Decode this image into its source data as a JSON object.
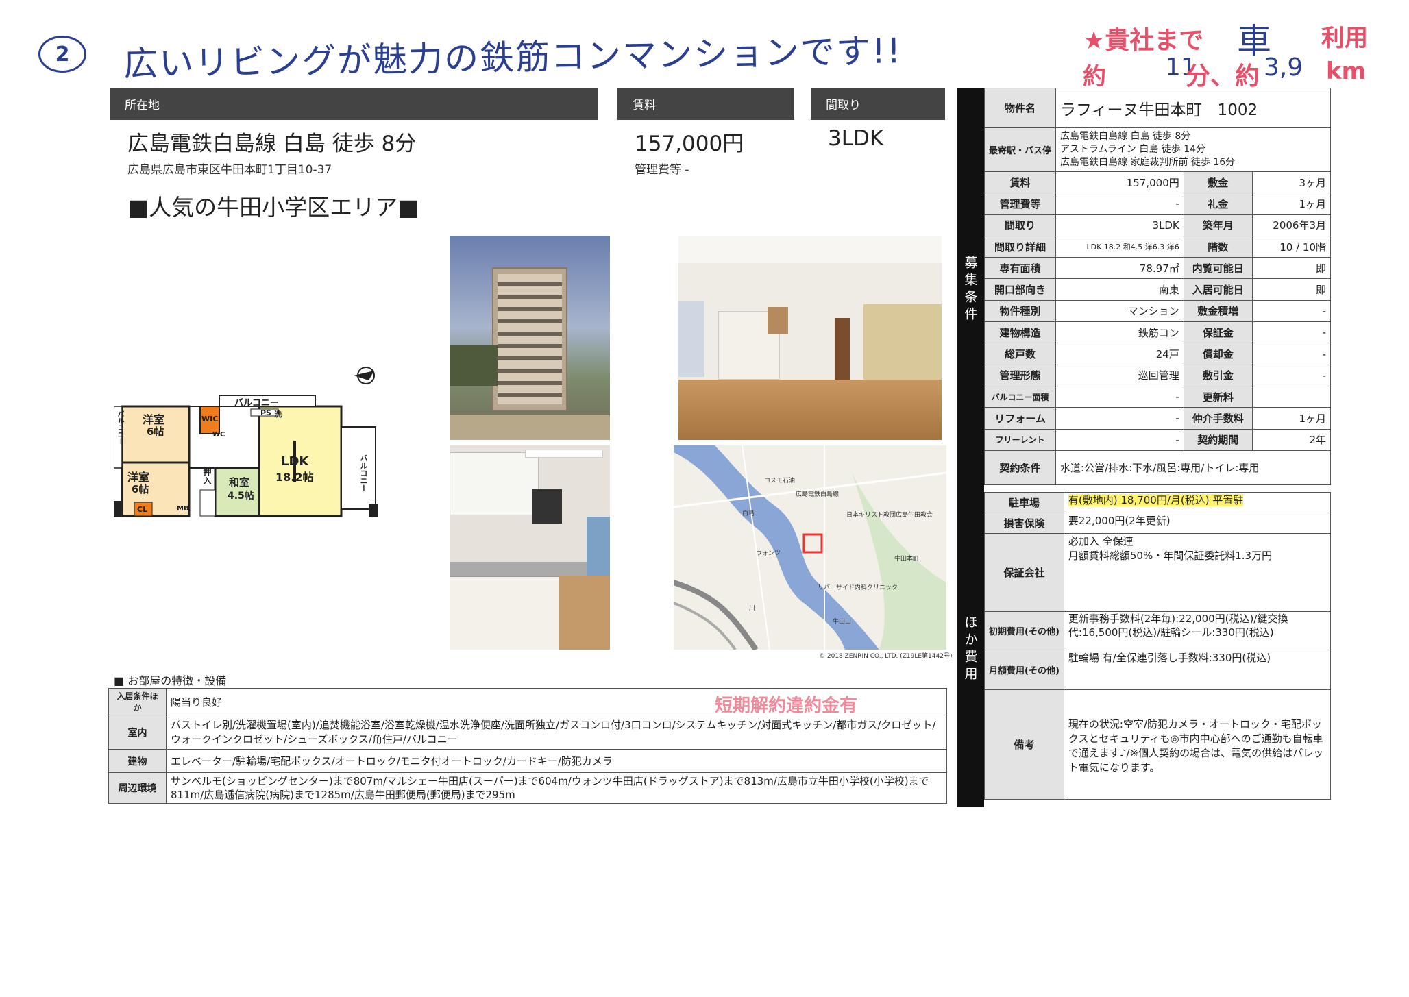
{
  "handwritten": {
    "circle_number": "2",
    "headline": "広いリビングが魅力の鉄筋コンマンションです!!"
  },
  "stamp": {
    "line1": "★貴社まで",
    "line1_hand": "車",
    "line1_right": "利用",
    "line2": "約",
    "line2_hand": "11",
    "line2_mid": "分、約",
    "line2_hand2": "3,9",
    "line2_unit": "km"
  },
  "location": {
    "label": "所在地",
    "station": "広島電鉄白島線 白島 徒歩 8分",
    "address": "広島県広島市東区牛田本町1丁目10-37"
  },
  "rent": {
    "label": "賃料",
    "value": "157,000円",
    "mgmt": "管理費等 -"
  },
  "layout": {
    "label": "間取り",
    "value": "3LDK"
  },
  "catch": "■人気の牛田小学区エリア■",
  "floorplan": {
    "balcony_top": "バルコニー",
    "room1": "洋室",
    "room1_size": "6帖",
    "room2": "洋室",
    "room2_size": "6帖",
    "ldk": "LDK",
    "ldk_size": "18.2帖",
    "washitsu": "和室",
    "washitsu_size": "4.5帖",
    "wic": "WIC",
    "ps": "PS",
    "sen": "洗",
    "cl": "CL",
    "mb": "MB",
    "oshi": "押入",
    "wc": "WC",
    "balcony_right": "バルコニー",
    "balcony_left": "バルコニー"
  },
  "map": {
    "copyright": "© 2018 ZENRIN CO., LTD. (Z19LE第1442号)",
    "labels": [
      "コスモ石油",
      "広島電鉄白島線",
      "日本キリスト教団広島牛田教会",
      "リバーサイド内科クリニック",
      "牛田本町",
      "白島",
      "ウォンツ",
      "川",
      "牛田山"
    ]
  },
  "sections": {
    "recruit": "募集条件",
    "other": "ほか費用"
  },
  "spec": {
    "name_label": "物件名",
    "name": "ラフィーヌ牛田本町　1002",
    "station_label": "最寄駅・バス停",
    "stations": [
      "広島電鉄白島線 白島 徒歩 8分",
      "アストラムライン 白島 徒歩 14分",
      "広島電鉄白島線 家庭裁判所前 徒歩 16分"
    ],
    "rows": [
      [
        "賃料",
        "157,000円",
        "敷金",
        "3ヶ月"
      ],
      [
        "管理費等",
        "-",
        "礼金",
        "1ヶ月"
      ],
      [
        "間取り",
        "3LDK",
        "築年月",
        "2006年3月"
      ],
      [
        "間取り詳細",
        "LDK 18.2 和4.5 洋6.3 洋6",
        "階数",
        "10 / 10階"
      ],
      [
        "専有面積",
        "78.97㎡",
        "内覧可能日",
        "即"
      ],
      [
        "開口部向き",
        "南東",
        "入居可能日",
        "即"
      ],
      [
        "物件種別",
        "マンション",
        "敷金積増",
        "-"
      ],
      [
        "建物構造",
        "鉄筋コン",
        "保証金",
        "-"
      ],
      [
        "総戸数",
        "24戸",
        "償却金",
        "-"
      ],
      [
        "管理形態",
        "巡回管理",
        "敷引金",
        "-"
      ],
      [
        "バルコニー面積",
        "-",
        "更新料",
        ""
      ],
      [
        "リフォーム",
        "-",
        "仲介手数料",
        "1ヶ月"
      ],
      [
        "フリーレント",
        "-",
        "契約期間",
        "2年"
      ]
    ],
    "contract_label": "契約条件",
    "contract": "水道:公営/排水:下水/風呂:専用/トイレ:専用"
  },
  "other": {
    "parking_label": "駐車場",
    "parking": "有(敷地内) 18,700円/月(税込) 平置駐",
    "insurance_label": "損害保険",
    "insurance": "要22,000円(2年更新)",
    "guarantee_label": "保証会社",
    "guarantee1": "必加入 全保連",
    "guarantee2": "月額賃料総額50%・年間保証委託料1.3万円",
    "initial_label": "初期費用(その他)",
    "initial": "更新事務手数料(2年毎):22,000円(税込)/鍵交換代:16,500円(税込)/駐輪シール:330円(税込)",
    "monthly_label": "月額費用(その他)",
    "monthly": "駐輪場 有/全保連引落し手数料:330円(税込)",
    "remarks_label": "備考",
    "remarks": "現在の状況:空室/防犯カメラ・オートロック・宅配ボックスとセキュリティも◎市内中心部へのご通勤も自転車で通えます♪/※個人契約の場合は、電気の供給はパレット電気になります。"
  },
  "features": {
    "title": "■ お部屋の特徴・設備",
    "stamp": "短期解約違約金有",
    "rows": [
      {
        "label": "入居条件ほか",
        "text": "陽当り良好"
      },
      {
        "label": "室内",
        "text": "バストイレ別/洗濯機置場(室内)/追焚機能浴室/浴室乾燥機/温水洗浄便座/洗面所独立/ガスコンロ付/3口コンロ/システムキッチン/対面式キッチン/都市ガス/クロゼット/ウォークインクロゼット/シューズボックス/角住戸/バルコニー"
      },
      {
        "label": "建物",
        "text": "エレベーター/駐輪場/宅配ボックス/オートロック/モニタ付オートロック/カードキー/防犯カメラ"
      },
      {
        "label": "周辺環境",
        "text": "サンベルモ(ショッピングセンター)まで807m/マルシェー牛田店(スーパー)まで604m/ウォンツ牛田店(ドラッグストア)まで813m/広島市立牛田小学校(小学校)まで811m/広島逓信病院(病院)まで1285m/広島牛田郵便局(郵便局)まで295m"
      }
    ]
  },
  "colors": {
    "header": "#444444",
    "label_bg": "#e3e3e3",
    "hand": "#2a3f8f",
    "stamp": "#e8506a",
    "highlight": "#fff36b"
  }
}
